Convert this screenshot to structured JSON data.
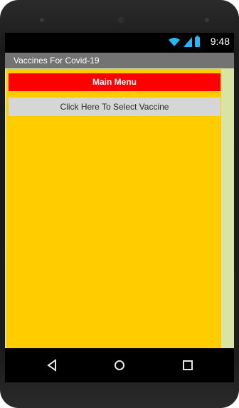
{
  "status_bar": {
    "time": "9:48",
    "icons": [
      "wifi-icon",
      "signal-icon",
      "battery-icon"
    ]
  },
  "app": {
    "title": "Vaccines For Covid-19"
  },
  "main": {
    "banner_label": "Main Menu",
    "select_button_label": "Click Here To Select Vaccine"
  },
  "nav": {
    "back_icon": "back-triangle-icon",
    "home_icon": "home-circle-icon",
    "recent_icon": "recent-square-icon"
  },
  "colors": {
    "title_bar": "#737373",
    "panel": "#ffcc00",
    "banner": "#ff0000",
    "select_button": "#d6d6d6",
    "side_strip": "#d9e3a3"
  }
}
